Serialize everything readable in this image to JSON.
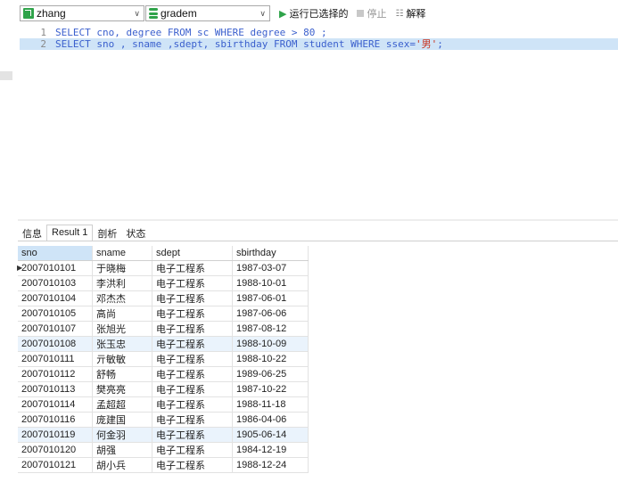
{
  "toolbar": {
    "connection": "zhang",
    "database": "gradem",
    "run_selected_label": "运行已选择的",
    "stop_label": "停止",
    "explain_label": "解释"
  },
  "editor": {
    "lines": [
      {
        "num": "1",
        "text": "SELECT cno, degree FROM sc WHERE degree > 80 ;"
      },
      {
        "num": "2",
        "text_before": "SELECT sno , sname ,sdept, sbirthday FROM student WHERE ssex=",
        "string": "'男'",
        "text_after": ";"
      }
    ]
  },
  "tabs": [
    "信息",
    "Result 1",
    "剖析",
    "状态"
  ],
  "result": {
    "columns": [
      "sno",
      "sname",
      "sdept",
      "sbirthday"
    ],
    "rows": [
      [
        "2007010101",
        "于晓梅",
        "电子工程系",
        "1987-03-07"
      ],
      [
        "2007010103",
        "李洪利",
        "电子工程系",
        "1988-10-01"
      ],
      [
        "2007010104",
        "邓杰杰",
        "电子工程系",
        "1987-06-01"
      ],
      [
        "2007010105",
        "高尚",
        "电子工程系",
        "1987-06-06"
      ],
      [
        "2007010107",
        "张旭光",
        "电子工程系",
        "1987-08-12"
      ],
      [
        "2007010108",
        "张玉忠",
        "电子工程系",
        "1988-10-09"
      ],
      [
        "2007010111",
        "亓敏敏",
        "电子工程系",
        "1988-10-22"
      ],
      [
        "2007010112",
        "舒畅",
        "电子工程系",
        "1989-06-25"
      ],
      [
        "2007010113",
        "樊亮亮",
        "电子工程系",
        "1987-10-22"
      ],
      [
        "2007010114",
        "孟超超",
        "电子工程系",
        "1988-11-18"
      ],
      [
        "2007010116",
        "庞建国",
        "电子工程系",
        "1986-04-06"
      ],
      [
        "2007010119",
        "何金羽",
        "电子工程系",
        "1905-06-14"
      ],
      [
        "2007010120",
        "胡强",
        "电子工程系",
        "1984-12-19"
      ],
      [
        "2007010121",
        "胡小兵",
        "电子工程系",
        "1988-12-24"
      ]
    ]
  }
}
